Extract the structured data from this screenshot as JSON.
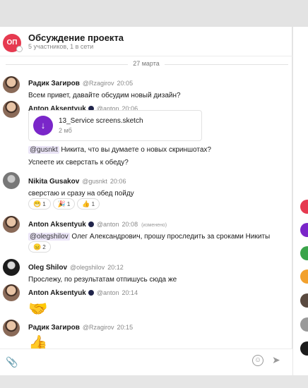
{
  "conversation": {
    "avatar_initials": "ОП",
    "title": "Обсуждение проекта",
    "subtitle": "5 участников, 1 в сети"
  },
  "date_separator": "27 марта",
  "messages": [
    {
      "name": "Радик Загиров",
      "handle": "@Rzagirov",
      "time": "20:05",
      "text": "Всем привет, давайте обсудим новый дизайн?"
    },
    {
      "name": "Anton Aksentyuk",
      "handle": "@anton",
      "time": "20:06",
      "file": {
        "name": "13_Service screens.sketch",
        "size": "2 мб"
      },
      "mention": "@gusnkt",
      "text": "Никита, что вы думаете о новых скриншотах?",
      "text2": "Успеете их сверстать к обеду?"
    },
    {
      "name": "Nikita Gusakov",
      "handle": "@gusnkt",
      "time": "20:06",
      "text": "сверстаю и сразу на обед пойду",
      "reactions": [
        {
          "emoji": "😁",
          "count": "1"
        },
        {
          "emoji": "🎉",
          "count": "1"
        },
        {
          "emoji": "👍",
          "count": "1"
        }
      ]
    },
    {
      "name": "Anton Aksentyuk",
      "handle": "@anton",
      "time": "20:08",
      "edited": "(изменено)",
      "mention": "@olegshilov",
      "text": "Олег Александрович, прошу проследить за сроками Никиты",
      "reactions": [
        {
          "emoji": "😑",
          "count": "2"
        }
      ]
    },
    {
      "name": "Oleg Shilov",
      "handle": "@olegshilov",
      "time": "20:12",
      "text": "Прослежу, по результатам отпишусь сюда же"
    },
    {
      "name": "Anton Aksentyuk",
      "handle": "@anton",
      "time": "20:14",
      "emoji": "🤝"
    },
    {
      "name": "Радик Загиров",
      "handle": "@Rzagirov",
      "time": "20:15",
      "emoji": "👍"
    }
  ],
  "composer": {
    "attach_icon": "paperclip-icon",
    "emoji_icon": "smiley-icon",
    "send_icon": "send-icon"
  },
  "colors": {
    "accent": "#7a26c9",
    "conversation_avatar": "#e63a50",
    "mention_bg": "#ebe5f7"
  }
}
